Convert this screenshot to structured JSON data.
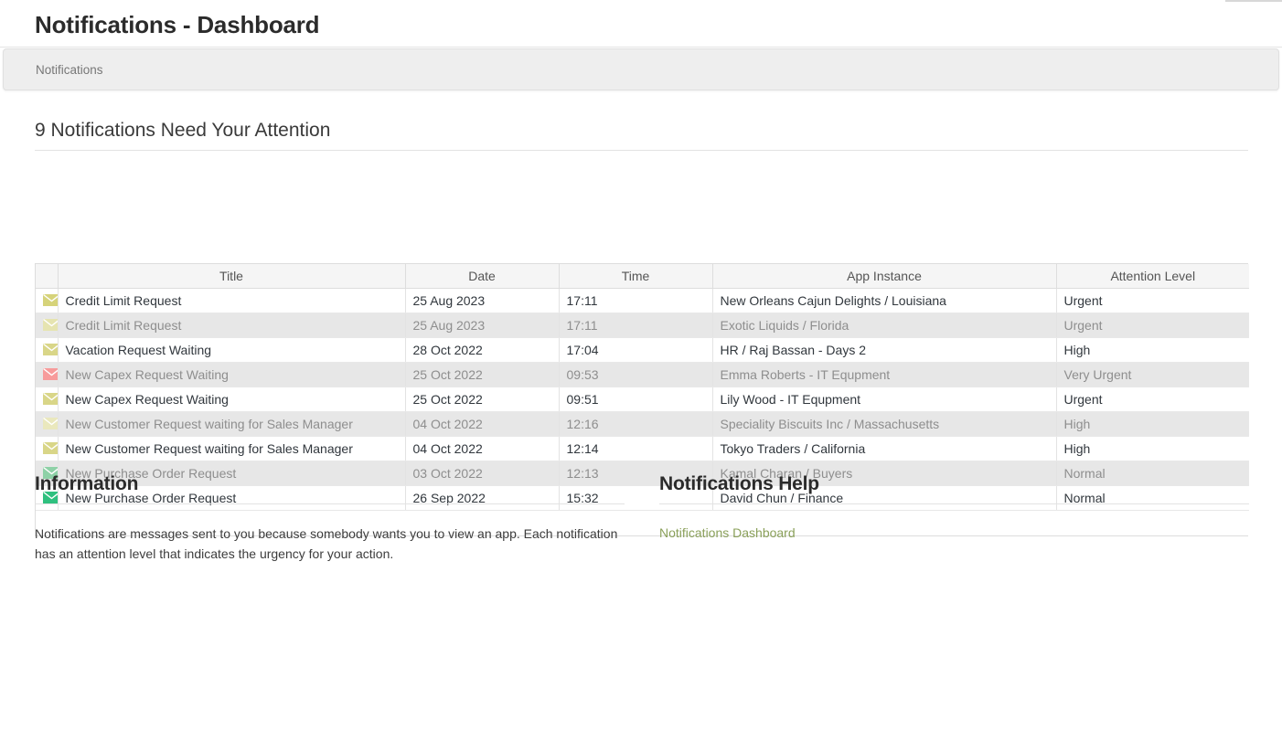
{
  "header": {
    "page_title": "Notifications - Dashboard",
    "breadcrumb": "Notifications"
  },
  "attention": {
    "heading": "9 Notifications Need Your Attention"
  },
  "table": {
    "columns": [
      "",
      "Title",
      "Date",
      "Time",
      "App Instance",
      "Attention Level"
    ],
    "rows": [
      {
        "icon": "envelope-icon",
        "icon_color": "#d6d37a",
        "title": "Credit Limit Request",
        "date": "25 Aug 2023",
        "time": "17:11",
        "app_instance": "New Orleans Cajun Delights / Louisiana",
        "attention_level": "Urgent"
      },
      {
        "icon": "envelope-icon",
        "icon_color": "#e6e4b0",
        "title": "Credit Limit Request",
        "date": "25 Aug 2023",
        "time": "17:11",
        "app_instance": "Exotic Liquids / Florida",
        "attention_level": "Urgent"
      },
      {
        "icon": "envelope-icon",
        "icon_color": "#d9d688",
        "title": "Vacation Request Waiting",
        "date": "28 Oct 2022",
        "time": "17:04",
        "app_instance": "HR / Raj Bassan - Days 2",
        "attention_level": "High"
      },
      {
        "icon": "envelope-icon",
        "icon_color": "#f79b9b",
        "title": "New Capex Request Waiting",
        "date": "25 Oct 2022",
        "time": "09:53",
        "app_instance": "Emma Roberts - IT Equpment",
        "attention_level": "Very Urgent"
      },
      {
        "icon": "envelope-icon",
        "icon_color": "#d9d688",
        "title": "New Capex Request Waiting",
        "date": "25 Oct 2022",
        "time": "09:51",
        "app_instance": "Lily Wood - IT Equpment",
        "attention_level": "Urgent"
      },
      {
        "icon": "envelope-icon",
        "icon_color": "#eae8bd",
        "title": "New Customer Request waiting for Sales Manager",
        "date": "04 Oct 2022",
        "time": "12:16",
        "app_instance": "Speciality Biscuits Inc / Massachusetts",
        "attention_level": "High"
      },
      {
        "icon": "envelope-icon",
        "icon_color": "#d9d688",
        "title": "New Customer Request waiting for Sales Manager",
        "date": "04 Oct 2022",
        "time": "12:14",
        "app_instance": "Tokyo Traders / California",
        "attention_level": "High"
      },
      {
        "icon": "envelope-icon",
        "icon_color": "#8ed1a7",
        "title": "New Purchase Order Request",
        "date": "03 Oct 2022",
        "time": "12:13",
        "app_instance": "Kamal Charan / Buyers",
        "attention_level": "Normal"
      },
      {
        "icon": "envelope-icon",
        "icon_color": "#2fc07f",
        "title": "New Purchase Order Request",
        "date": "26 Sep 2022",
        "time": "15:32",
        "app_instance": "David Chun / Finance",
        "attention_level": "Normal"
      }
    ]
  },
  "information": {
    "heading": "Information",
    "text": "Notifications are messages sent to you because somebody wants you to view an app. Each notification has an attention level that indicates the urgency for your action."
  },
  "help": {
    "heading": "Notifications Help",
    "link_label": "Notifications Dashboard",
    "link_color": "#8aa05a"
  }
}
